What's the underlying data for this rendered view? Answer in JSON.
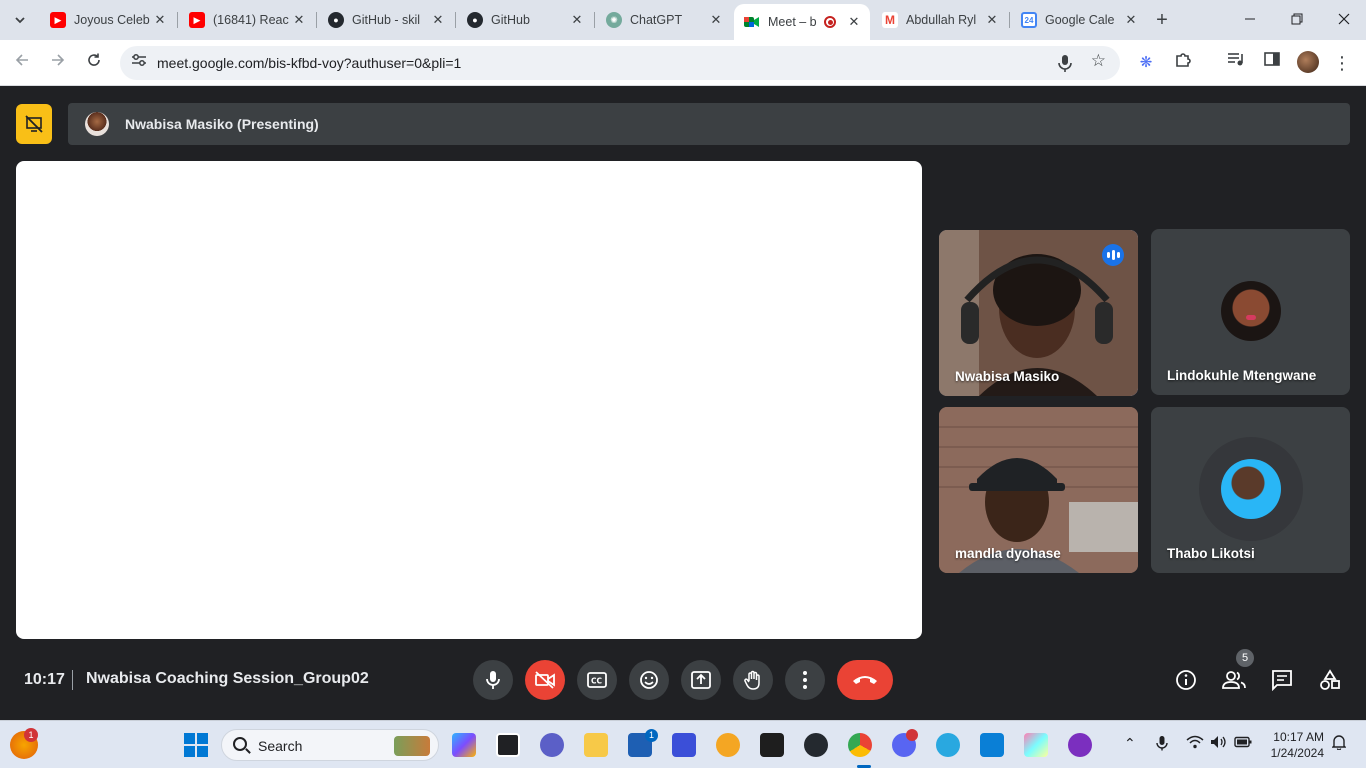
{
  "browser": {
    "tabs": [
      {
        "title": "Joyous Celeb",
        "favicon": "youtube-icon"
      },
      {
        "title": "(16841) Reac",
        "favicon": "youtube-icon"
      },
      {
        "title": "GitHub - skil",
        "favicon": "github-icon"
      },
      {
        "title": "GitHub",
        "favicon": "github-icon"
      },
      {
        "title": "ChatGPT",
        "favicon": "chatgpt-icon"
      },
      {
        "title": "Meet – b",
        "favicon": "google-meet-icon",
        "active": true,
        "recording": true
      },
      {
        "title": "Abdullah Ryl",
        "favicon": "gmail-icon"
      },
      {
        "title": "Google Cale",
        "favicon": "google-calendar-icon"
      }
    ],
    "close_glyph": "✕",
    "new_tab_glyph": "+",
    "url": "meet.google.com/bis-kfbd-voy?authuser=0&pli=1"
  },
  "meet": {
    "presenter_bar_label": "Nwabisa Masiko (Presenting)",
    "participants": [
      {
        "name": "Nwabisa Masiko",
        "video": true,
        "speaking": true
      },
      {
        "name": "Lindokuhle Mtengwane",
        "video": false
      },
      {
        "name": "mandla dyohase",
        "video": true
      },
      {
        "name": "Thabo Likotsi",
        "video": false
      }
    ],
    "time": "10:17",
    "meeting_name": "Nwabisa Coaching Session_Group02",
    "people_count": "5",
    "colors": {
      "accent": "#8ab4f8",
      "end_call": "#ea4335",
      "present_badge": "#f9bf17",
      "background": "#202124"
    }
  },
  "taskbar": {
    "search_label": "Search",
    "widgets_badge": "1",
    "store_badge": "1",
    "clock_time": "10:17 AM",
    "clock_date": "1/24/2024"
  }
}
